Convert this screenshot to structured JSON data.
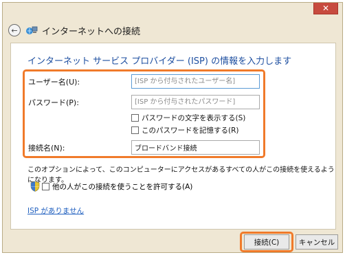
{
  "window": {
    "title": "インターネットへの接続",
    "close_symbol": "✕",
    "back_symbol": "←"
  },
  "heading": "インターネット サービス プロバイダー (ISP) の情報を入力します",
  "form": {
    "username_label": "ユーザー名(U):",
    "username_placeholder": "[ISP から付与されたユーザー名]",
    "password_label": "パスワード(P):",
    "password_placeholder": "[ISP から付与されたパスワード]",
    "show_password_label": "パスワードの文字を表示する(S)",
    "remember_password_label": "このパスワードを記憶する(R)",
    "connection_name_label": "接続名(N):",
    "connection_name_value": "ブロードバンド接続"
  },
  "info_text": "このオプションによって、このコンピューターにアクセスがあるすべての人がこの接続を使えるようになります。",
  "allow_others_label": "他の人がこの接続を使うことを許可する(A)",
  "no_isp_link": "ISP がありません",
  "buttons": {
    "connect": "接続(C)",
    "cancel": "キャンセル"
  },
  "colors": {
    "highlight": "#f07a2a",
    "heading": "#1e4fa0",
    "link": "#1f5fbf",
    "window_frame": "#efe7d4",
    "close_button": "#c74b3f"
  }
}
